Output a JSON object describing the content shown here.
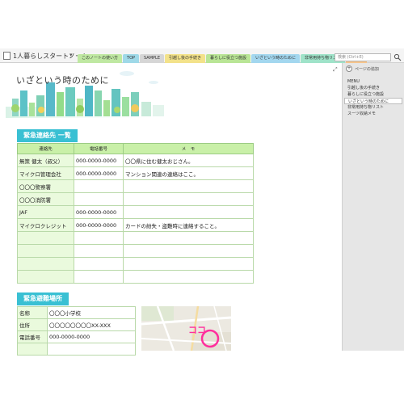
{
  "notebook": {
    "title": "1人暮らしスタートノート",
    "dropdown": "▾"
  },
  "tabs": [
    {
      "label": "このノートの使い方",
      "color": "#bfe8a2"
    },
    {
      "label": "TOP",
      "color": "#9fd9e8"
    },
    {
      "label": "SAMPLE",
      "color": "#d6d6d6"
    },
    {
      "label": "引越し後の手続き",
      "color": "#f3e28a"
    },
    {
      "label": "暮らしに役立つ施設",
      "color": "#b9e596"
    },
    {
      "label": "いざという時のために",
      "color": "#a3d7ef"
    },
    {
      "label": "非常用持ち物リスト",
      "color": "#9fe3c9"
    },
    {
      "label": "MEMO",
      "color": "#f6c48b"
    }
  ],
  "tab_add": "+",
  "search": {
    "placeholder": "検索 (Ctrl+E)"
  },
  "right_pane": {
    "add_page": "ページの追加",
    "add_page_symbol": "+",
    "pages": [
      "MENU",
      "引越し後の手続き",
      "暮らしに役立つ施設",
      "いざという時のために",
      "非常用持ち物リスト",
      "スーツ収納メモ"
    ],
    "selected_index": 3
  },
  "expand_symbol": "⤢",
  "banner": {
    "title": "いざという時のために"
  },
  "contacts": {
    "heading": "緊急連絡先 一覧",
    "headers": [
      "連絡先",
      "電話番号",
      "メ　モ"
    ],
    "rows": [
      [
        "無策 健太（叔父）",
        "000-0000-0000",
        "〇〇県に住む健太おじさん。"
      ],
      [
        "マイクロ管理会社",
        "000-0000-0000",
        "マンション関連の連絡はここ。"
      ],
      [
        "〇〇〇警察署",
        "",
        ""
      ],
      [
        "〇〇〇消防署",
        "",
        ""
      ],
      [
        "JAF",
        "000-0000-0000",
        ""
      ],
      [
        "マイクロクレジット",
        "000-0000-0000",
        "カードの紛失・盗難時に連絡すること。"
      ],
      [
        "",
        "",
        ""
      ],
      [
        "",
        "",
        ""
      ],
      [
        "",
        "",
        ""
      ],
      [
        "",
        "",
        ""
      ]
    ]
  },
  "shelter": {
    "heading": "緊急避難場所",
    "rows": [
      [
        "名称",
        "〇〇〇小学校"
      ],
      [
        "住所",
        "〇〇〇〇〇〇〇〇XX-XXX"
      ],
      [
        "電話番号",
        "000-0000-0000"
      ]
    ]
  },
  "map": {
    "label": "ココ"
  },
  "colors": {
    "accent": "#39c0d3",
    "header_green": "#c9f0a8",
    "first_col": "#eafadd",
    "pane": "#e6e6e6"
  }
}
